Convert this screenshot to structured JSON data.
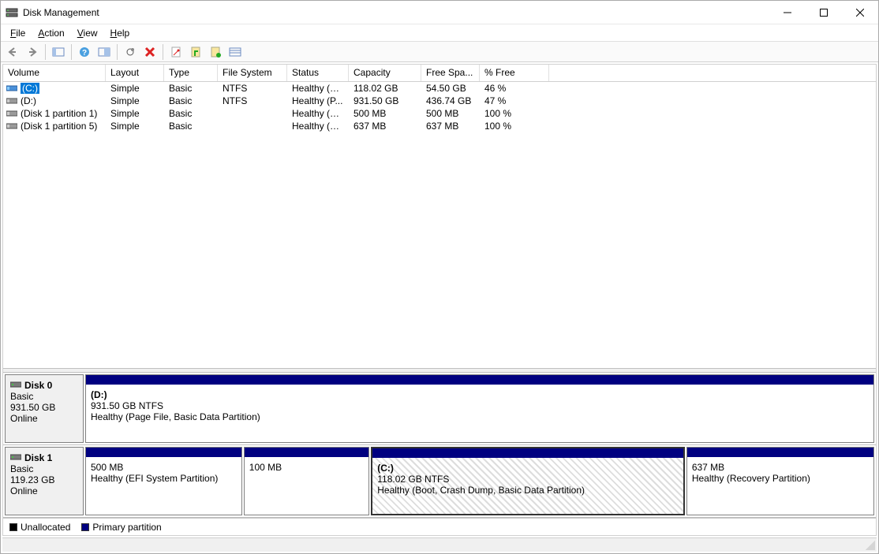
{
  "window": {
    "title": "Disk Management"
  },
  "menus": {
    "file": "File",
    "action": "Action",
    "view": "View",
    "help": "Help"
  },
  "columns": {
    "volume": "Volume",
    "layout": "Layout",
    "type": "Type",
    "filesystem": "File System",
    "status": "Status",
    "capacity": "Capacity",
    "freespace": "Free Spa...",
    "pctfree": "% Free"
  },
  "volumes": [
    {
      "icon": "drive-sel",
      "name": "(C:)",
      "layout": "Simple",
      "type": "Basic",
      "fs": "NTFS",
      "status": "Healthy (B...",
      "capacity": "118.02 GB",
      "free": "54.50 GB",
      "pct": "46 %",
      "selected": true
    },
    {
      "icon": "drive",
      "name": "(D:)",
      "layout": "Simple",
      "type": "Basic",
      "fs": "NTFS",
      "status": "Healthy (P...",
      "capacity": "931.50 GB",
      "free": "436.74 GB",
      "pct": "47 %",
      "selected": false
    },
    {
      "icon": "drive",
      "name": "(Disk 1 partition 1)",
      "layout": "Simple",
      "type": "Basic",
      "fs": "",
      "status": "Healthy (E...",
      "capacity": "500 MB",
      "free": "500 MB",
      "pct": "100 %",
      "selected": false
    },
    {
      "icon": "drive",
      "name": "(Disk 1 partition 5)",
      "layout": "Simple",
      "type": "Basic",
      "fs": "",
      "status": "Healthy (R...",
      "capacity": "637 MB",
      "free": "637 MB",
      "pct": "100 %",
      "selected": false
    }
  ],
  "disks": [
    {
      "title": "Disk 0",
      "type": "Basic",
      "size": "931.50 GB",
      "status": "Online",
      "partitions": [
        {
          "name": "(D:)",
          "info": "931.50 GB NTFS",
          "status": "Healthy (Page File, Basic Data Partition)",
          "widthPct": 100,
          "selected": false
        }
      ]
    },
    {
      "title": "Disk 1",
      "type": "Basic",
      "size": "119.23 GB",
      "status": "Online",
      "partitions": [
        {
          "name": "",
          "info": "500 MB",
          "status": "Healthy (EFI System Partition)",
          "widthPct": 20,
          "selected": false
        },
        {
          "name": "",
          "info": "100 MB",
          "status": "",
          "widthPct": 16,
          "selected": false
        },
        {
          "name": "(C:)",
          "info": "118.02 GB NTFS",
          "status": "Healthy (Boot, Crash Dump, Basic Data Partition)",
          "widthPct": 40,
          "selected": true
        },
        {
          "name": "",
          "info": "637 MB",
          "status": "Healthy (Recovery Partition)",
          "widthPct": 24,
          "selected": false
        }
      ]
    }
  ],
  "legend": {
    "unallocated": "Unallocated",
    "primary": "Primary partition"
  }
}
